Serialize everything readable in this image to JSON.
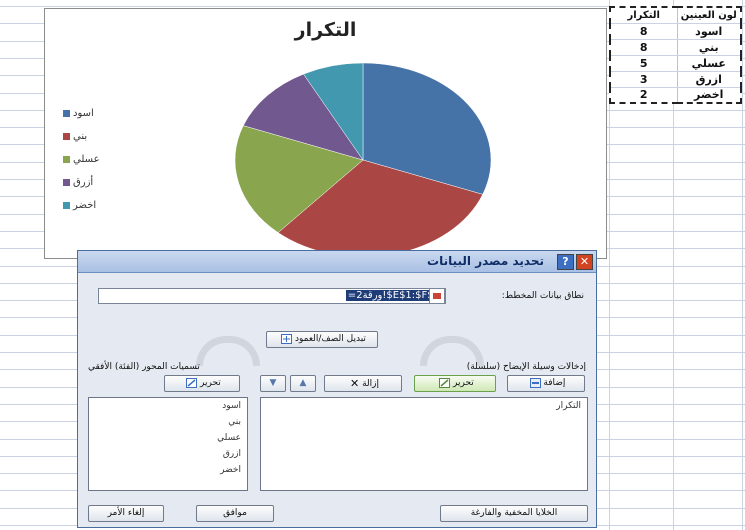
{
  "sheet": {
    "table": {
      "headers": [
        "لون العينين",
        "التكرار"
      ],
      "rows": [
        {
          "color": "اسود",
          "count": "8"
        },
        {
          "color": "بني",
          "count": "8"
        },
        {
          "color": "عسلي",
          "count": "5"
        },
        {
          "color": "ازرق",
          "count": "3"
        },
        {
          "color": "اخضر",
          "count": "2"
        }
      ]
    }
  },
  "chart_data": {
    "type": "pie",
    "title": "التكرار",
    "categories": [
      "اسود",
      "بني",
      "عسلي",
      "أزرق",
      "اخضر"
    ],
    "values": [
      8,
      8,
      5,
      3,
      2
    ],
    "colors": [
      "#4572a7",
      "#aa4643",
      "#89a54e",
      "#71588f",
      "#4198af"
    ],
    "legend_position": "left"
  },
  "dialog": {
    "title": "تحديد مصدر البيانات",
    "range_label": "نطاق بيانات المخطط:",
    "range_value": "=ورقة2!$E$1:$F$6",
    "switch_button": "تبديل الصف/العمود",
    "series_section_label": "إدخالات وسيلة الإيضاح (سلسلة)",
    "category_section_label": "تسميات المحور (الفئة) الأفقي",
    "add_button": "إضافة",
    "edit_button": "تحرير",
    "remove_button": "إزالة",
    "edit_category_button": "تحرير",
    "series_items": [
      "التكرار"
    ],
    "category_items": [
      "اسود",
      "بني",
      "عسلي",
      "ازرق",
      "اخضر"
    ],
    "hidden_cells_button": "الخلايا المخفية والفارغة",
    "ok_button": "موافق",
    "cancel_button": "إلغاء الأمر",
    "help_symbol": "?",
    "close_symbol": "✕"
  }
}
